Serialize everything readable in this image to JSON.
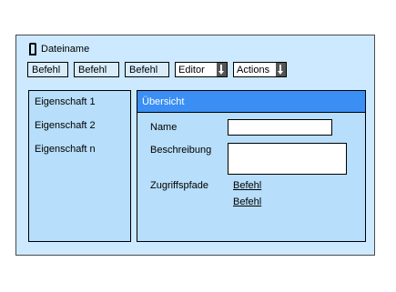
{
  "window": {
    "title": "Dateiname"
  },
  "toolbar": {
    "buttons": [
      "Befehl",
      "Befehl",
      "Befehl"
    ],
    "editor_label": "Editor",
    "actions_label": "Actions"
  },
  "sidebar": {
    "items": [
      {
        "label": "Eigenschaft 1"
      },
      {
        "label": "Eigenschaft 2"
      },
      {
        "label": "Eigenschaft n"
      }
    ]
  },
  "overview": {
    "header": "Übersicht",
    "name_label": "Name",
    "name_value": "",
    "description_label": "Beschreibung",
    "description_value": "",
    "paths_label": "Zugriffspfade",
    "links": [
      "Befehl",
      "Befehl"
    ]
  }
}
